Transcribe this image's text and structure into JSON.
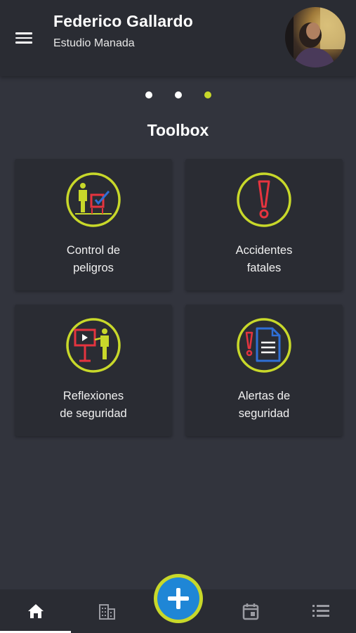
{
  "header": {
    "user_name": "Federico Gallardo",
    "organization": "Estudio Manada"
  },
  "carousel": {
    "pages": 3,
    "active_page": 3
  },
  "section": {
    "title": "Toolbox"
  },
  "cards": [
    {
      "line1": "Control de",
      "line2": "peligros",
      "icon": "hazard-control-icon"
    },
    {
      "line1": "Accidentes",
      "line2": "fatales",
      "icon": "exclamation-icon"
    },
    {
      "line1": "Reflexiones",
      "line2": "de seguridad",
      "icon": "presentation-icon"
    },
    {
      "line1": "Alertas de",
      "line2": "seguridad",
      "icon": "alert-document-icon"
    }
  ],
  "bottom_nav": {
    "items": [
      "home-icon",
      "building-icon",
      "calendar-icon",
      "list-icon"
    ],
    "active": "home-icon"
  },
  "colors": {
    "accent": "#c8d82a",
    "fab_blue": "#1f86d6",
    "icon_red": "#e5343f",
    "icon_blue": "#2f6fd6",
    "background": "#32343d",
    "surface": "#2a2c33"
  }
}
